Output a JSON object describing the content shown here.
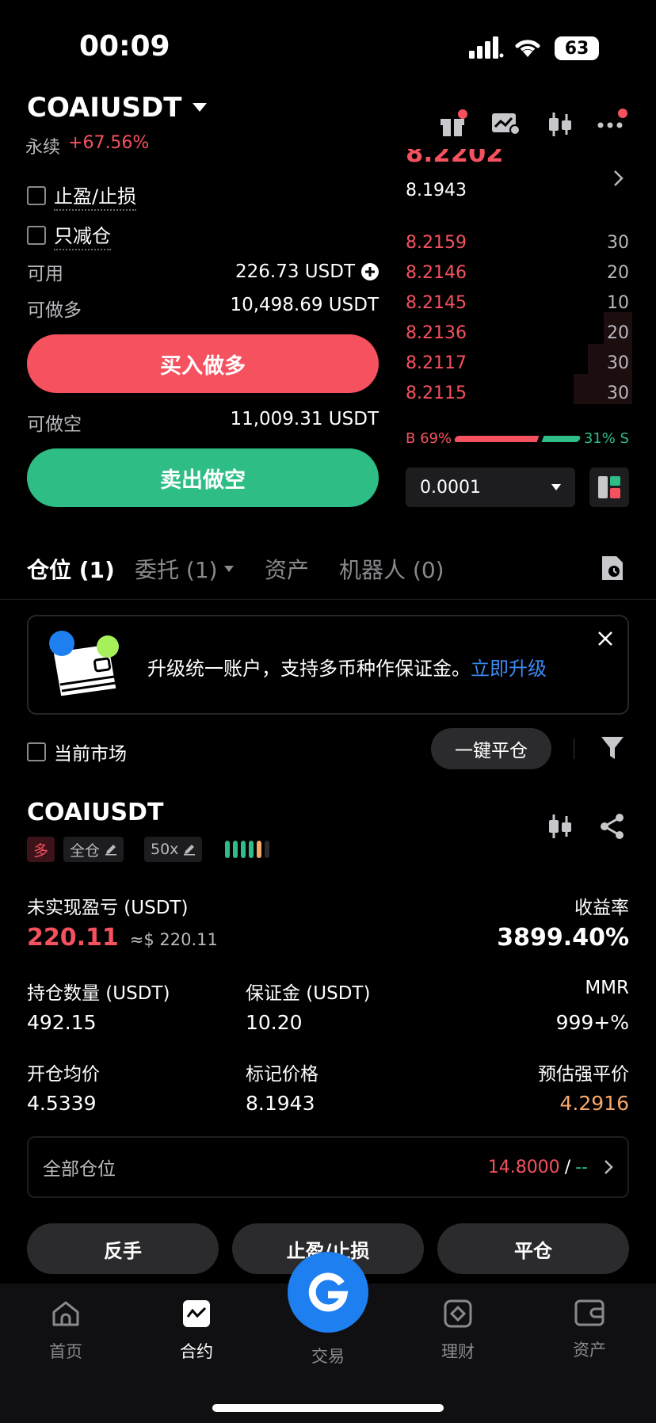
{
  "status_bar": {
    "time": "00:09",
    "battery": "63"
  },
  "header": {
    "pair": "COAIUSDT",
    "type_label": "永续",
    "change": "+67.56%"
  },
  "order_form": {
    "tp_sl_label": "止盈/止损",
    "reduce_only_label": "只减仓",
    "available_label": "可用",
    "available_value": "226.73 USDT",
    "can_long_label": "可做多",
    "can_long_value": "10,498.69 USDT",
    "buy_label": "买入做多",
    "can_short_label": "可做空",
    "can_short_value": "11,009.31 USDT",
    "sell_label": "卖出做空"
  },
  "orderbook": {
    "last_price_partial": "8.2202",
    "mark_price": "8.1943",
    "bids": [
      {
        "price": "8.2159",
        "qty": "30"
      },
      {
        "price": "8.2146",
        "qty": "20"
      },
      {
        "price": "8.2145",
        "qty": "10"
      },
      {
        "price": "8.2136",
        "qty": "20"
      },
      {
        "price": "8.2117",
        "qty": "30"
      },
      {
        "price": "8.2115",
        "qty": "30"
      }
    ],
    "buy_ratio_label": "B 69%",
    "sell_ratio_label": "31% S",
    "buy_ratio": 0.69,
    "precision": "0.0001"
  },
  "tabs": {
    "positions": "仓位 (1)",
    "orders": "委托 (1)",
    "assets": "资产",
    "bots": "机器人 (0)"
  },
  "banner": {
    "text": "升级统一账户，支持多币种作保证金。",
    "link": "立即升级"
  },
  "filter": {
    "current_market_label": "当前市场",
    "close_all_label": "一键平仓"
  },
  "position": {
    "symbol": "COAIUSDT",
    "side_tag": "多",
    "margin_mode": "全仓",
    "leverage": "50x",
    "unrealized_pnl_label": "未实现盈亏 (USDT)",
    "unrealized_pnl": "220.11",
    "unrealized_pnl_usd": "≈$ 220.11",
    "roe_label": "收益率",
    "roe": "3899.40%",
    "size_label": "持仓数量 (USDT)",
    "size": "492.15",
    "margin_label": "保证金 (USDT)",
    "margin": "10.20",
    "mmr_label": "MMR",
    "mmr": "999+%",
    "entry_label": "开仓均价",
    "entry": "4.5339",
    "mark_label": "标记价格",
    "mark": "8.1943",
    "liq_label": "预估强平价",
    "liq": "4.2916",
    "all_positions_label": "全部仓位",
    "all_positions_value": "14.8000",
    "all_positions_sep": "/",
    "all_positions_dash": "--",
    "reverse_label": "反手",
    "tp_sl_label": "止盈/止损",
    "close_label": "平仓"
  },
  "bottom_nav": [
    {
      "label": "首页",
      "icon": "home-icon"
    },
    {
      "label": "合约",
      "icon": "futures-icon"
    },
    {
      "label": "交易",
      "icon": "trade-icon"
    },
    {
      "label": "理财",
      "icon": "earn-icon"
    },
    {
      "label": "资产",
      "icon": "wallet-icon"
    }
  ],
  "colors": {
    "red": "#f5515f",
    "green": "#2ebd85",
    "blue": "#1e7ff0",
    "orange": "#f6a86b"
  }
}
